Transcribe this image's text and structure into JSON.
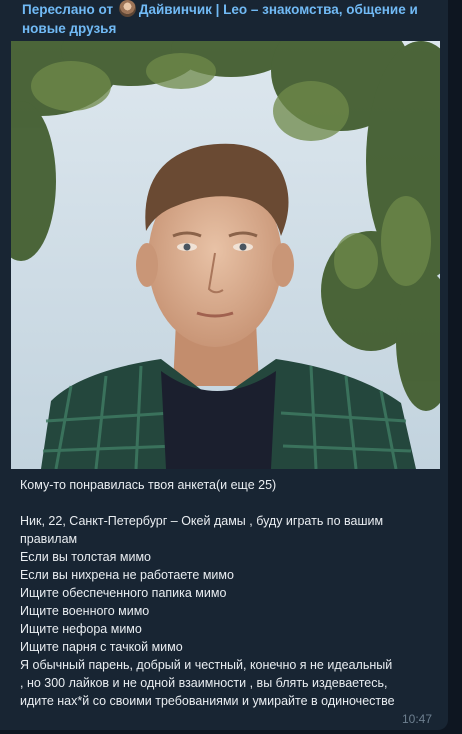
{
  "message": {
    "forward": {
      "prefix": "Переслано от",
      "source": "Дайвинчик | Leo – знакомства, общение и новые друзья"
    },
    "caption_lines": [
      "Кому-то понравилась твоя анкета(и еще 25)",
      "",
      "Ник, 22, Санкт-Петербург – Окей дамы , буду играть по вашим правилам",
      "Если вы толстая мимо",
      "Если вы нихрена не работаете мимо",
      "Ищите обеспеченного папика мимо",
      "Ищите военного мимо",
      "Ищите нефора мимо",
      "Ищите парня с тачкой мимо",
      "Я обычный парень, добрый и честный, конечно я не идеальный",
      ", но  300 лайков и не одной взаимности , вы блять издеваетесь,",
      "идите нах*й со своими требованиями и умирайте в одиночестве"
    ],
    "time": "10:47"
  },
  "colors": {
    "background": "#0e1621",
    "bubble": "#182533",
    "forward_text": "#71baf5",
    "message_text": "#e9edf1",
    "time_text": "#6d7f8f"
  }
}
